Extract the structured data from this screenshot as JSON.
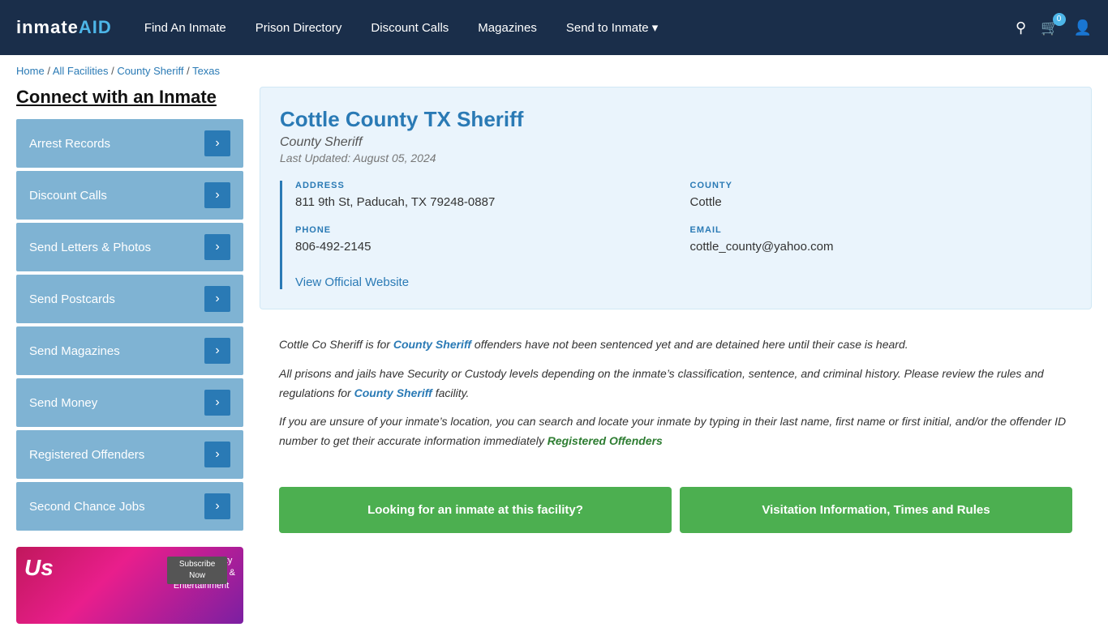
{
  "nav": {
    "logo": "inmate",
    "logo_suffix": "AID",
    "links": [
      {
        "label": "Find An Inmate"
      },
      {
        "label": "Prison Directory"
      },
      {
        "label": "Discount Calls"
      },
      {
        "label": "Magazines"
      },
      {
        "label": "Send to Inmate ▾"
      }
    ],
    "cart_count": "0"
  },
  "breadcrumb": {
    "home": "Home",
    "all_facilities": "All Facilities",
    "county_sheriff": "County Sheriff",
    "texas": "Texas"
  },
  "sidebar": {
    "title": "Connect with an Inmate",
    "items": [
      {
        "label": "Arrest Records"
      },
      {
        "label": "Discount Calls"
      },
      {
        "label": "Send Letters & Photos"
      },
      {
        "label": "Send Postcards"
      },
      {
        "label": "Send Magazines"
      },
      {
        "label": "Send Money"
      },
      {
        "label": "Registered Offenders"
      },
      {
        "label": "Second Chance Jobs"
      }
    ]
  },
  "ad": {
    "logo": "Us",
    "line1": "Latest Celebrity",
    "line2": "News, Pictures &",
    "line3": "Entertainment",
    "subscribe": "Subscribe Now"
  },
  "facility": {
    "name": "Cottle County TX Sheriff",
    "type": "County Sheriff",
    "last_updated": "Last Updated: August 05, 2024",
    "address_label": "ADDRESS",
    "address_value": "811 9th St, Paducah, TX 79248-0887",
    "county_label": "COUNTY",
    "county_value": "Cottle",
    "phone_label": "PHONE",
    "phone_value": "806-492-2145",
    "email_label": "EMAIL",
    "email_value": "cottle_county@yahoo.com",
    "website_link": "View Official Website"
  },
  "description": {
    "para1_before": "Cottle Co Sheriff is for ",
    "highlight1": "County Sheriff",
    "para1_after": " offenders have not been sentenced yet and are detained here until their case is heard.",
    "para2": "All prisons and jails have Security or Custody levels depending on the inmate’s classification, sentence, and criminal history. Please review the rules and regulations for ",
    "highlight2": "County Sheriff",
    "para2_after": " facility.",
    "para3_before": "If you are unsure of your inmate’s location, you can search and locate your inmate by typing in their last name, first name or first initial, and/or the offender ID number to get their accurate information immediately ",
    "highlight3": "Registered Offenders"
  },
  "buttons": {
    "btn1": "Looking for an inmate at this facility?",
    "btn2": "Visitation Information, Times and Rules"
  }
}
